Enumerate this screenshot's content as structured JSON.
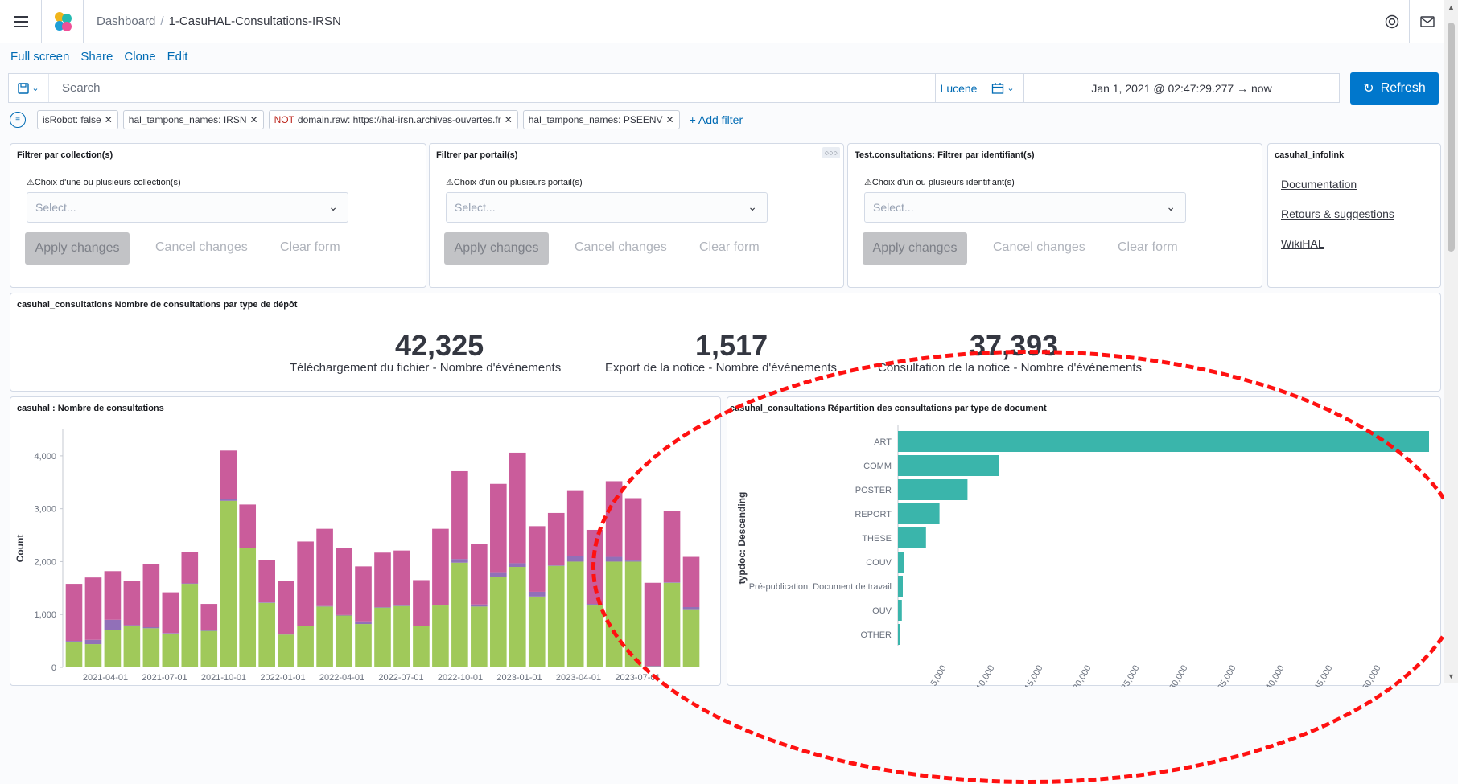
{
  "header": {
    "breadcrumb_root": "Dashboard",
    "breadcrumb_sep": "/",
    "breadcrumb_current": "1-CasuHAL-Consultations-IRSN"
  },
  "nav": {
    "full_screen": "Full screen",
    "share": "Share",
    "clone": "Clone",
    "edit": "Edit"
  },
  "query": {
    "search_placeholder": "Search",
    "language": "Lucene",
    "date_range": "Jan 1, 2021 @ 02:47:29.277 → now",
    "refresh_label": "Refresh"
  },
  "filters": [
    {
      "label": "isRobot: false"
    },
    {
      "label": "hal_tampons_names: IRSN"
    },
    {
      "prefix": "NOT",
      "label": "domain.raw: https://hal-irsn.archives-ouvertes.fr"
    },
    {
      "label": "hal_tampons_names: PSEENV"
    }
  ],
  "add_filter": "+ Add filter",
  "controls": [
    {
      "title": "Filtrer par collection(s)",
      "label": "⚠Choix d'une ou plusieurs collection(s)",
      "placeholder": "Select...",
      "apply": "Apply changes",
      "cancel": "Cancel changes",
      "clear": "Clear form"
    },
    {
      "title": "Filtrer par portail(s)",
      "label": "⚠Choix d'un ou plusieurs portail(s)",
      "placeholder": "Select...",
      "apply": "Apply changes",
      "cancel": "Cancel changes",
      "clear": "Clear form"
    },
    {
      "title": "Test.consultations: Filtrer par identifiant(s)",
      "label": "⚠Choix d'un ou plusieurs identifiant(s)",
      "placeholder": "Select...",
      "apply": "Apply changes",
      "cancel": "Cancel changes",
      "clear": "Clear form"
    }
  ],
  "infolink": {
    "title": "casuhal_infolink",
    "links": [
      "Documentation",
      "Retours & suggestions",
      "WikiHAL"
    ]
  },
  "metrics": {
    "title": "casuhal_consultations Nombre de consultations par type de dépôt",
    "items": [
      {
        "value": "42,325",
        "label": "Téléchargement du fichier - Nombre d'événements"
      },
      {
        "value": "1,517",
        "label": "Export de la notice - Nombre d'événements"
      },
      {
        "value": "37,393",
        "label": "Consultation de la notice - Nombre d'événements"
      }
    ]
  },
  "chart_data": [
    {
      "type": "bar",
      "stacked": true,
      "title": "casuhal : Nombre de consultations",
      "ylabel": "Count",
      "ylim": [
        0,
        4500
      ],
      "yticks": [
        "0",
        "1,000",
        "2,000",
        "3,000",
        "4,000"
      ],
      "xtick_labels": [
        "2021-04-01",
        "2021-07-01",
        "2021-10-01",
        "2022-01-01",
        "2022-04-01",
        "2022-07-01",
        "2022-10-01",
        "2023-01-01",
        "2023-04-01",
        "2023-07-01"
      ],
      "colors": [
        "#a0c95a",
        "#9170b8",
        "#ca5c9b"
      ],
      "series": [
        {
          "values": [
            480,
            440,
            700,
            780,
            740,
            640,
            1580,
            690,
            3150,
            2250,
            1220,
            620,
            780,
            1150,
            980,
            820,
            1130,
            1160,
            780,
            1170,
            1980,
            1150,
            1710,
            1900,
            1340,
            1920,
            2000,
            1170,
            2000,
            2000,
            20,
            1600,
            1100
          ]
        },
        {
          "values": [
            20,
            80,
            200,
            20,
            20,
            10,
            10,
            10,
            30,
            10,
            10,
            10,
            10,
            10,
            10,
            50,
            10,
            10,
            10,
            10,
            70,
            40,
            90,
            70,
            90,
            10,
            100,
            30,
            90,
            20,
            10,
            10,
            40
          ]
        },
        {
          "values": [
            1080,
            1180,
            920,
            840,
            1190,
            770,
            590,
            500,
            920,
            820,
            800,
            1010,
            1590,
            1460,
            1260,
            1040,
            1030,
            1040,
            860,
            1440,
            1660,
            1150,
            1670,
            2090,
            1240,
            990,
            1250,
            1400,
            1430,
            1180,
            1570,
            1350,
            950
          ]
        }
      ],
      "series_count": 33
    },
    {
      "type": "bar",
      "orientation": "horizontal",
      "title": "casuhal_consultations Répartition des consultations par type de document",
      "ylabel": "typdoc: Descending",
      "color": "#3ab5ab",
      "categories": [
        "ART",
        "COMM",
        "POSTER",
        "REPORT",
        "THESE",
        "COUV",
        "Pré-publication, Document de travail",
        "OUV",
        "OTHER"
      ],
      "values": [
        55000,
        10500,
        7200,
        4300,
        2900,
        600,
        500,
        400,
        150
      ],
      "xticks": [
        "5,000",
        "10,000",
        "15,000",
        "20,000",
        "25,000",
        "30,000",
        "35,000",
        "40,000",
        "45,000",
        "50,000"
      ],
      "xlim": [
        0,
        55000
      ]
    }
  ]
}
